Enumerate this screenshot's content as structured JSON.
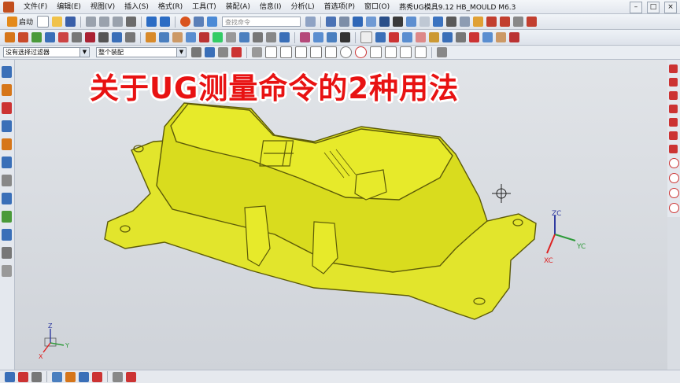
{
  "window": {
    "title": "燕秀UG模具9.12   HB_MOULD  M6.3"
  },
  "menu": [
    "文件(F)",
    "编辑(E)",
    "视图(V)",
    "插入(S)",
    "格式(R)",
    "工具(T)",
    "装配(A)",
    "信息(I)",
    "分析(L)",
    "首选项(P)",
    "窗口(O)"
  ],
  "toolbar": {
    "start_label": "启动",
    "search_placeholder": "查找命令"
  },
  "filters": {
    "selection_filter": "没有选择过滤器",
    "assembly_scope": "整个装配"
  },
  "viewport": {
    "caption": "关于UG测量命令的2种用法",
    "triad": {
      "x": "XC",
      "y": "YC",
      "z": "ZC"
    },
    "mini_triad": {
      "x": "X",
      "y": "Y",
      "z": "Z"
    }
  },
  "colors": {
    "part": "#e7ea2a",
    "part_edge": "#5c5a08",
    "caption": "#e81212"
  }
}
